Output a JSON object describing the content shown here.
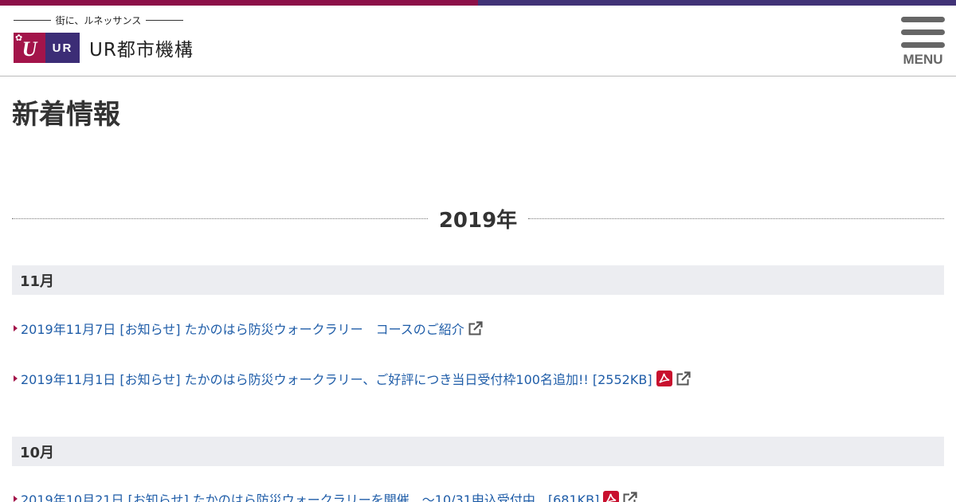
{
  "colors": {
    "topbar_left": "#8c1048",
    "topbar_right": "#413377",
    "logo_mark": "#a3144a",
    "logo_ur": "#3c2d76",
    "link": "#1f5da8",
    "month_bg": "#ecedf1",
    "arrow": "#a3144a",
    "pdf": "#c8102e"
  },
  "header": {
    "tagline": "街に、ルネッサンス",
    "logo_ur": "UR",
    "logo_name": "UR都市機構",
    "menu_label": "MENU"
  },
  "page": {
    "title": "新着情報"
  },
  "news": {
    "year": "2019年",
    "months": [
      {
        "label": "11月",
        "items": [
          {
            "text": "2019年11月7日 [お知らせ] たかのはら防災ウォークラリー　コースのご紹介",
            "pdf": false,
            "external": true
          },
          {
            "text": "2019年11月1日 [お知らせ] たかのはら防災ウォークラリー、ご好評につき当日受付枠100名追加!! [2552KB]",
            "pdf": true,
            "external": true
          }
        ]
      },
      {
        "label": "10月",
        "items": [
          {
            "text": "2019年10月21日 [お知らせ] たかのはら防災ウォークラリーを開催　～10/31申込受付中　[681KB]",
            "pdf": true,
            "external": true
          }
        ]
      }
    ]
  }
}
